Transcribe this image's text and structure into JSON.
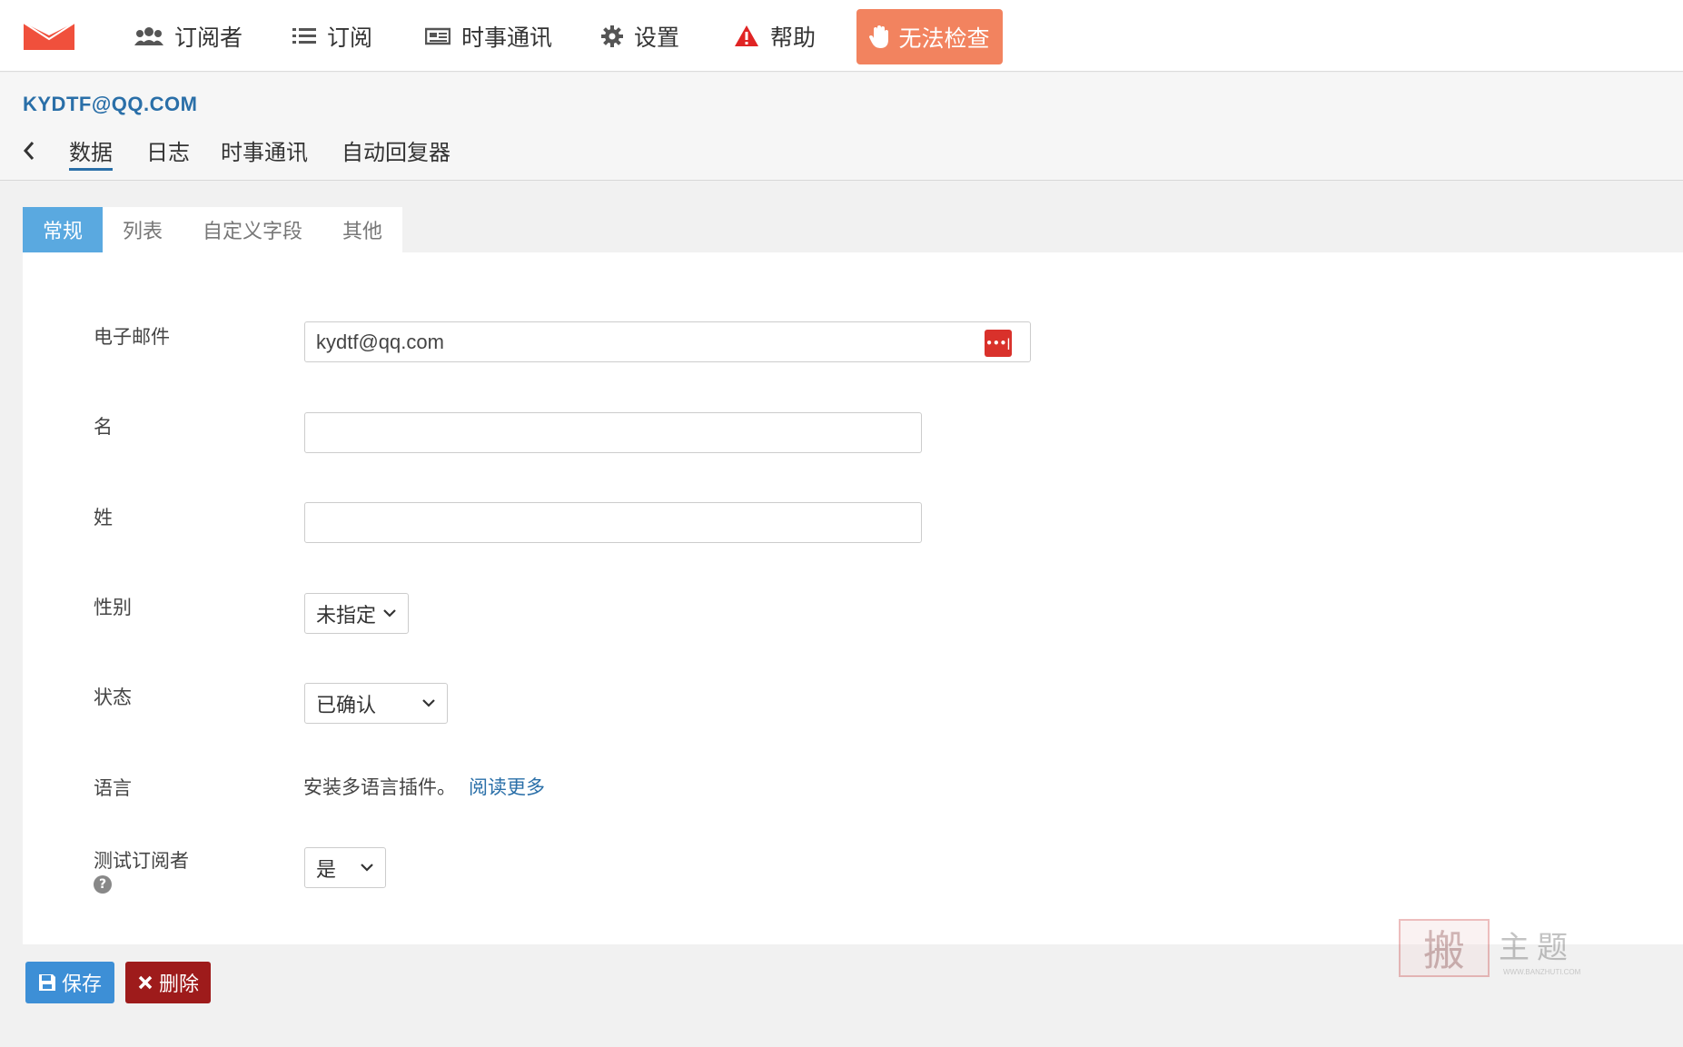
{
  "nav": {
    "items": [
      {
        "label": "订阅者",
        "icon": "users-icon"
      },
      {
        "label": "订阅",
        "icon": "list-icon"
      },
      {
        "label": "时事通讯",
        "icon": "newspaper-icon"
      },
      {
        "label": "设置",
        "icon": "gear-icon"
      },
      {
        "label": "帮助",
        "icon": "warning-icon"
      }
    ],
    "warn_label": "无法检查"
  },
  "header": {
    "email": "KYDTF@QQ.COM",
    "tabs": [
      "数据",
      "日志",
      "时事通讯",
      "自动回复器"
    ]
  },
  "inner_tabs": [
    "常规",
    "列表",
    "自定义字段",
    "其他"
  ],
  "form": {
    "email_label": "电子邮件",
    "email_value": "kydtf@qq.com",
    "first_name_label": "名",
    "first_name_value": "",
    "last_name_label": "姓",
    "last_name_value": "",
    "gender_label": "性别",
    "gender_value": "未指定",
    "status_label": "状态",
    "status_value": "已确认",
    "language_label": "语言",
    "language_text": "安装多语言插件。",
    "language_link": "阅读更多",
    "test_label": "测试订阅者",
    "test_value": "是"
  },
  "actions": {
    "save": "保存",
    "delete": "删除"
  },
  "watermark": {
    "seal": "搬",
    "title": "主题",
    "url": "WWW.BANZHUTI.COM"
  },
  "colors": {
    "accent": "#2a6fa8",
    "tab_active": "#5aa9e0",
    "warn": "#f2835f",
    "save": "#3d8fd6",
    "delete": "#9e1b1b"
  }
}
